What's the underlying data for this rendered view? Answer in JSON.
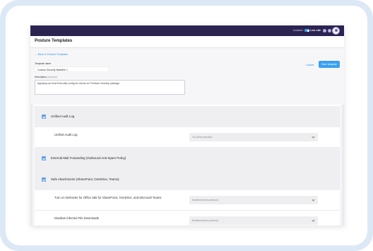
{
  "header": {
    "availability_label": "Available",
    "live_label": "Live site",
    "page_title": "Posture Templates"
  },
  "form": {
    "back_link": "← Back to Posture Templates",
    "name_label": "Template name",
    "name_value": "Custom Security Baseline 1",
    "desc_label": "Description",
    "desc_optional": "(optional)",
    "desc_value": "Applying our best Executify config for clients on Premium Security package",
    "cancel_label": "Cancel",
    "save_label": "Save template"
  },
  "sections": [
    {
      "title": "Unified Audit Log"
    },
    {
      "title": "External Mail Forwarding (Outbound Anti-Spam Policy)"
    },
    {
      "title": "Safe Attachments (SharePoint, OneDrive, Teams)"
    }
  ],
  "settings": [
    {
      "label": "Unified Audit Log",
      "value": "On (best practice)"
    },
    {
      "label": "Turn on Defender for Office 365 for SharePoint, OneDrive, and Microsoft Teams",
      "value": "Enabled (best practice)"
    },
    {
      "label": "Disallow Infected File Downloads",
      "value": "Enabled (best practice)"
    }
  ],
  "colors": {
    "topbar": "#2b2451",
    "accent": "#3aa0ef",
    "checkbox": "#5e9ee8"
  },
  "icons": [
    "toggle-switch-icon",
    "bell-icon",
    "help-icon",
    "user-avatar-icon",
    "checkbox-checked-icon",
    "chevron-down-icon"
  ]
}
